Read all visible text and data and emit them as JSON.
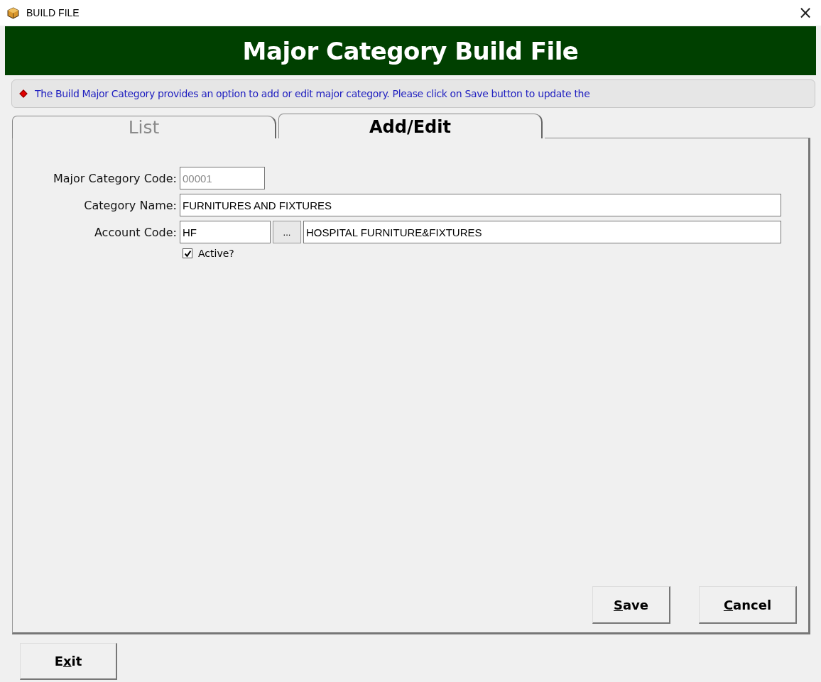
{
  "window": {
    "title": "BUILD FILE",
    "close": "×"
  },
  "header": {
    "title": "Major Category Build File"
  },
  "info": {
    "text": "The Build Major Category provides an option to add or edit major category. Please click on Save button to update the"
  },
  "tabs": [
    {
      "label": "List",
      "selected": false
    },
    {
      "label": "Add/Edit",
      "selected": true
    }
  ],
  "form": {
    "fields": [
      {
        "label": "Major Category Code:",
        "kind": "code",
        "value": "00001",
        "disabled": true
      },
      {
        "label": "Category Name:",
        "kind": "text",
        "value": "FURNITURES AND FIXTURES",
        "disabled": false
      },
      {
        "label": "Account Code:",
        "kind": "lookup",
        "value": "HF",
        "button": "...",
        "description": "HOSPITAL FURNITURE&FIXTURES",
        "disabled": false
      }
    ],
    "active": {
      "label": "Active?",
      "checked": true
    }
  },
  "panel_buttons": [
    {
      "access_key": "S",
      "label_after": "ave"
    },
    {
      "access_key": "C",
      "label_after": "ancel"
    }
  ],
  "footer_buttons": [
    {
      "label_before": "E",
      "access_key": "x",
      "label_after": "it"
    }
  ]
}
